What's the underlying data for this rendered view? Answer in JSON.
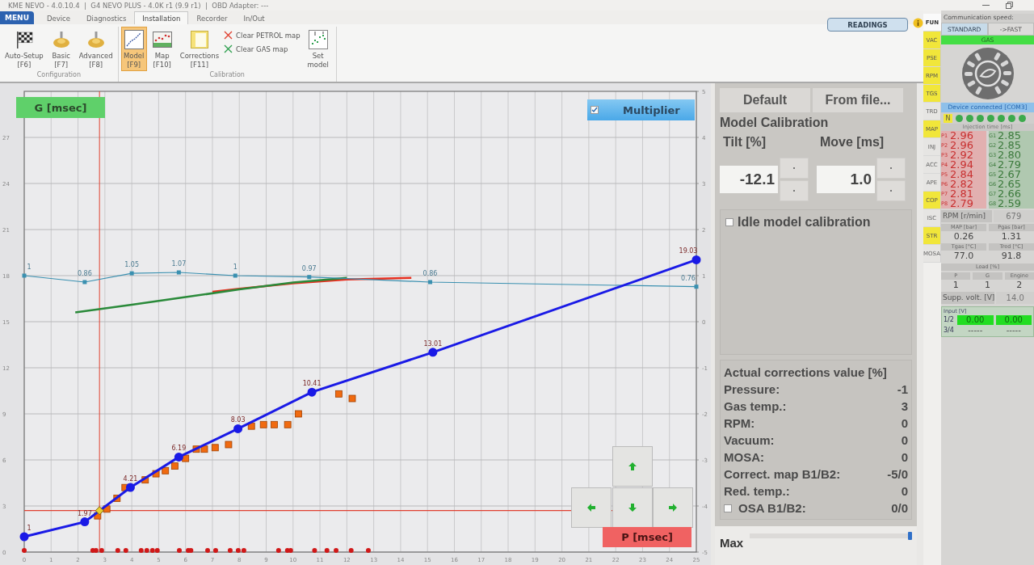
{
  "window": {
    "title": "KME NEVO - 4.0.10.4  |  G4 NEVO PLUS - 4.0K r1 (9.9 r1)  |  OBD Adapter: ---"
  },
  "menu_button": "MENU",
  "tabs": [
    {
      "label": "Device",
      "selected": false
    },
    {
      "label": "Diagnostics",
      "selected": false
    },
    {
      "label": "Installation",
      "selected": true
    },
    {
      "label": "Recorder",
      "selected": false
    },
    {
      "label": "In/Out",
      "selected": false
    }
  ],
  "ribbon": {
    "groups": [
      {
        "title": "Configuration",
        "items": [
          {
            "kind": "flag",
            "label": "Auto-Setup",
            "key": "[F6]",
            "selected": false
          },
          {
            "kind": "gear",
            "label": "Basic",
            "key": "[F7]",
            "selected": false
          },
          {
            "kind": "gear",
            "label": "Advanced",
            "key": "[F8]",
            "selected": false
          }
        ]
      },
      {
        "title": "Calibration",
        "items": [
          {
            "kind": "model",
            "label": "Model",
            "key": "[F9]",
            "selected": true
          },
          {
            "kind": "map",
            "label": "Map",
            "key": "[F10]",
            "selected": false
          },
          {
            "kind": "corrections",
            "label": "Corrections",
            "key": "[F11]",
            "selected": false
          },
          {
            "kind": "clear",
            "actions": [
              {
                "label": "Clear PETROL map",
                "color": "#e04030"
              },
              {
                "label": "Clear GAS map",
                "color": "#30a050"
              }
            ]
          },
          {
            "kind": "setmodel",
            "label": "Set model"
          }
        ]
      }
    ]
  },
  "readings_button": "READINGS",
  "side_tabs": [
    {
      "label": "FUN",
      "selected": true,
      "highlighted": false
    },
    {
      "label": "VAC",
      "selected": false,
      "highlighted": true
    },
    {
      "label": "PSE",
      "selected": false,
      "highlighted": true
    },
    {
      "label": "RPM",
      "selected": false,
      "highlighted": true
    },
    {
      "label": "TGS",
      "selected": false,
      "highlighted": true
    },
    {
      "label": "TRD",
      "selected": false,
      "highlighted": false
    },
    {
      "label": "MAP",
      "selected": false,
      "highlighted": true
    },
    {
      "label": "INJ",
      "selected": false,
      "highlighted": false
    },
    {
      "label": "ACC",
      "selected": false,
      "highlighted": false
    },
    {
      "label": "APE",
      "selected": false,
      "highlighted": false
    },
    {
      "label": "COP",
      "selected": false,
      "highlighted": true
    },
    {
      "label": "ISC",
      "selected": false,
      "highlighted": false
    },
    {
      "label": "STR",
      "selected": false,
      "highlighted": true
    },
    {
      "label": "MOSA",
      "selected": false,
      "highlighted": false
    }
  ],
  "device": {
    "comm_label": "Communication speed:",
    "speeds": [
      {
        "label": "STANDARD",
        "selected": true
      },
      {
        "label": "->FAST",
        "selected": false
      }
    ],
    "fuel": "GAS",
    "status": "Device connected [COM3]",
    "indicator": "N",
    "leds": [
      {
        "on": true
      },
      {
        "on": true
      },
      {
        "on": true
      },
      {
        "on": true
      },
      {
        "on": true
      },
      {
        "on": true
      },
      {
        "on": true
      }
    ],
    "injection": {
      "title": "Injection time [ms]",
      "rows": [
        {
          "p_label": "P1",
          "p": "2.96",
          "g_label": "G1",
          "g": "2.85"
        },
        {
          "p_label": "P2",
          "p": "2.96",
          "g_label": "G2",
          "g": "2.85"
        },
        {
          "p_label": "P3",
          "p": "2.92",
          "g_label": "G3",
          "g": "2.80"
        },
        {
          "p_label": "P4",
          "p": "2.94",
          "g_label": "G4",
          "g": "2.79"
        },
        {
          "p_label": "P5",
          "p": "2.84",
          "g_label": "G5",
          "g": "2.67"
        },
        {
          "p_label": "P6",
          "p": "2.82",
          "g_label": "G6",
          "g": "2.65"
        },
        {
          "p_label": "P7",
          "p": "2.81",
          "g_label": "G7",
          "g": "2.66"
        },
        {
          "p_label": "P8",
          "p": "2.79",
          "g_label": "G8",
          "g": "2.59"
        }
      ]
    },
    "rpm": {
      "label": "RPM [r/min]",
      "value": "679"
    },
    "pairs": [
      [
        {
          "label": "MAP [bar]",
          "value": "0.26"
        },
        {
          "label": "Pgas [bar]",
          "value": "1.31"
        }
      ],
      [
        {
          "label": "Tgas [°C]",
          "value": "77.0"
        },
        {
          "label": "Tred [°C]",
          "value": "91.8"
        }
      ]
    ],
    "load": {
      "title": "Load [%]",
      "cols": [
        {
          "label": "P",
          "value": "1"
        },
        {
          "label": "G",
          "value": "1"
        },
        {
          "label": "Engine",
          "value": "2"
        }
      ]
    },
    "supply": {
      "label": "Supp. volt. [V]",
      "value": "14.0"
    },
    "input": {
      "title": "Input [V]",
      "rows": [
        {
          "label": "1/2",
          "values": [
            "0.00",
            "0.00"
          ],
          "active": true
        },
        {
          "label": "3/4",
          "values": [
            "-----",
            "-----"
          ],
          "active": false
        }
      ]
    }
  },
  "chart": {
    "y_axis_button": "G [msec]",
    "multiplier": {
      "label": "Multiplier",
      "checked": true
    },
    "x_axis_button": "P [msec]",
    "chart_data": {
      "type": "line",
      "xlim": [
        0,
        25
      ],
      "ylim": [
        0,
        30
      ],
      "y2lim": [
        -5,
        5
      ],
      "xticks": [
        0,
        1,
        2,
        3,
        4,
        5,
        6,
        7,
        8,
        9,
        10,
        11,
        12,
        13,
        14,
        15,
        16,
        17,
        18,
        19,
        20,
        21,
        22,
        23,
        24,
        25
      ],
      "yticks": [
        0,
        3,
        6,
        9,
        12,
        15,
        18,
        21,
        24,
        27
      ],
      "y2ticks": [
        -5,
        -4,
        -3,
        -2,
        -1,
        0,
        1,
        2,
        3,
        4,
        5
      ],
      "series": [
        {
          "type": "scatter",
          "marker": "circle",
          "color": "#d01818",
          "x": [
            0,
            2.55,
            2.67,
            2.88,
            3.48,
            3.78,
            4.35,
            4.56,
            4.77,
            4.95,
            5.77,
            6.1,
            6.2,
            6.82,
            7.12,
            7.66,
            7.96,
            8.17,
            9.46,
            9.79,
            9.91,
            10.8,
            11.26,
            11.6,
            12.16,
            12.8
          ],
          "values": [
            0,
            0,
            0,
            0,
            0,
            0,
            0,
            0,
            0,
            0,
            0,
            0,
            0,
            0,
            0,
            0,
            0,
            0,
            0,
            0,
            0,
            0,
            0,
            0,
            0,
            0
          ]
        },
        {
          "type": "line",
          "color": "#e83020",
          "x": [
            7,
            8,
            10,
            12,
            14.4
          ],
          "values": [
            16.95,
            17.15,
            17.5,
            17.75,
            17.85
          ]
        },
        {
          "type": "line",
          "color": "#2a8a3a",
          "x": [
            1.9,
            4,
            6,
            8,
            10,
            12
          ],
          "values": [
            15.6,
            16.1,
            16.6,
            17.1,
            17.55,
            17.85
          ]
        },
        {
          "type": "line",
          "marker": "square",
          "axis": "y2",
          "color": "#3a90b0",
          "x": [
            0,
            2.25,
            4.0,
            5.75,
            7.85,
            10.6,
            15.1,
            25
          ],
          "values": [
            1,
            0.86,
            1.05,
            1.07,
            1,
            0.97,
            0.86,
            0.76
          ],
          "value_labels": [
            "1",
            "0.86",
            "1.05",
            "1.07",
            "1",
            "0.97",
            "0.86",
            "0.76"
          ]
        },
        {
          "type": "scatter",
          "marker": "square",
          "color": "#f06a10",
          "x": [
            2.73,
            3.07,
            3.45,
            3.75,
            4.1,
            4.5,
            4.9,
            5.25,
            5.6,
            6.0,
            6.4,
            6.7,
            7.1,
            7.6,
            8.45,
            8.9,
            9.3,
            9.8,
            10.2,
            11.7,
            12.2
          ],
          "values": [
            2.36,
            2.8,
            3.5,
            4.2,
            null,
            4.7,
            5.1,
            5.3,
            5.6,
            6.1,
            6.7,
            6.7,
            6.8,
            7.0,
            8.2,
            8.3,
            8.3,
            8.3,
            9.0,
            10.3,
            10.0
          ]
        },
        {
          "type": "line",
          "marker": "circle",
          "color": "#1a1ae6",
          "x": [
            0,
            2.25,
            3.95,
            5.75,
            7.95,
            10.7,
            15.2,
            25
          ],
          "values": [
            1,
            1.97,
            4.21,
            6.19,
            8.03,
            10.41,
            13.01,
            19.03
          ],
          "value_labels": [
            "1",
            "1.97",
            "4.21",
            "6.19",
            "8.03",
            "10.41",
            "13.01",
            "19.03"
          ]
        }
      ],
      "grid": true,
      "ref_lines": [
        {
          "axis": "x",
          "value": 2.8,
          "color": "#e04030"
        },
        {
          "axis": "y",
          "value": 2.7,
          "color": "#e04030"
        }
      ]
    }
  },
  "calibration": {
    "buttons": [
      "Default",
      "From file..."
    ],
    "title": "Model Calibration",
    "spinners": [
      {
        "label": "Tilt [%]",
        "value": "-12.1"
      },
      {
        "label": "Move [ms]",
        "value": "1.0"
      }
    ],
    "idle": {
      "label": "Idle model calibration",
      "checked": false
    },
    "corrections": {
      "title": "Actual corrections value [%]",
      "rows": [
        {
          "kind": "plain",
          "label": "Pressure:",
          "value": "-1"
        },
        {
          "kind": "plain",
          "label": "Gas temp.:",
          "value": "3"
        },
        {
          "kind": "plain",
          "label": "RPM:",
          "value": "0"
        },
        {
          "kind": "plain",
          "label": "Vacuum:",
          "value": "0"
        },
        {
          "kind": "plain",
          "label": "MOSA:",
          "value": "0"
        },
        {
          "kind": "plain",
          "label": "Correct. map B1/B2:",
          "value": "-5/0"
        },
        {
          "kind": "plain",
          "label": "Red. temp.:",
          "value": "0"
        },
        {
          "kind": "check",
          "label": "OSA B1/B2:",
          "value": "0/0",
          "checked": false
        }
      ]
    },
    "max": {
      "label": "Max",
      "level": 1.0
    }
  }
}
